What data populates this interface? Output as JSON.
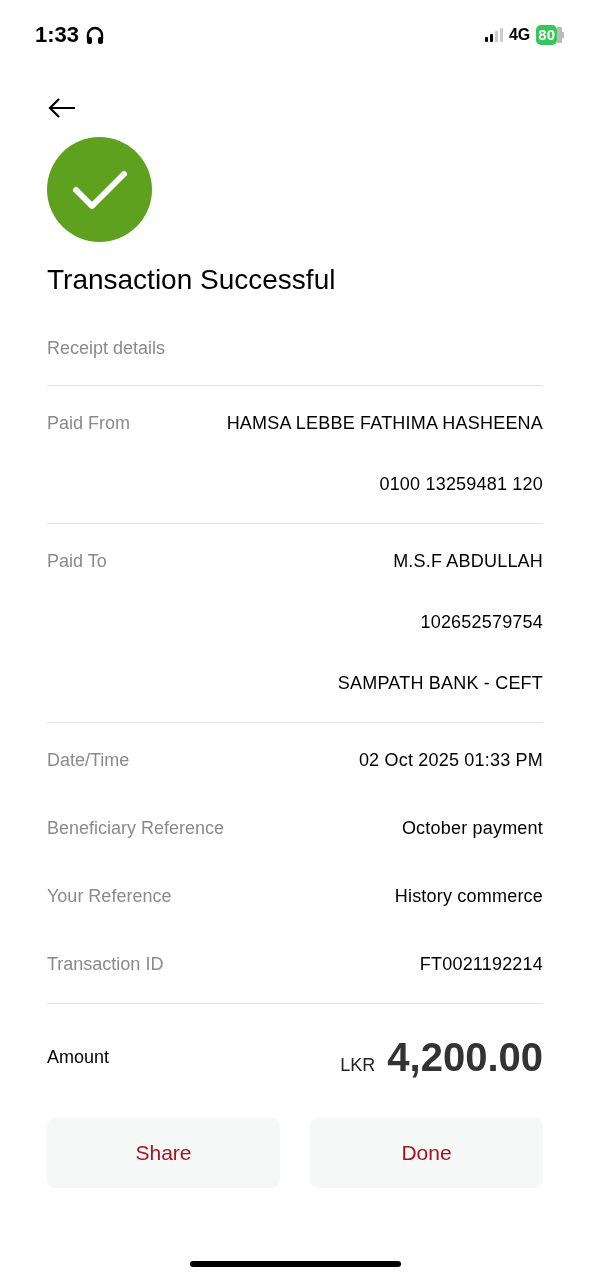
{
  "status_bar": {
    "time": "1:33",
    "network": "4G",
    "battery": "80"
  },
  "header": {
    "title": "Transaction Successful",
    "subtitle": "Receipt details"
  },
  "sections": [
    {
      "rows": [
        {
          "label": "Paid From",
          "values": [
            "HAMSA LEBBE FATHIMA HASHEENA",
            "0100 13259481 120"
          ]
        }
      ]
    },
    {
      "rows": [
        {
          "label": "Paid To",
          "values": [
            "M.S.F ABDULLAH",
            "102652579754",
            "SAMPATH BANK - CEFT"
          ]
        }
      ]
    },
    {
      "rows": [
        {
          "label": "Date/Time",
          "values": [
            "02 Oct 2025 01:33 PM"
          ]
        },
        {
          "label": "Beneficiary Reference",
          "values": [
            "October payment"
          ]
        },
        {
          "label": "Your Reference",
          "values": [
            "History commerce"
          ]
        },
        {
          "label": "Transaction ID",
          "values": [
            "FT0021192214"
          ]
        }
      ]
    }
  ],
  "amount": {
    "label": "Amount",
    "currency": "LKR",
    "value": "4,200.00"
  },
  "buttons": [
    "Share",
    "Done"
  ]
}
